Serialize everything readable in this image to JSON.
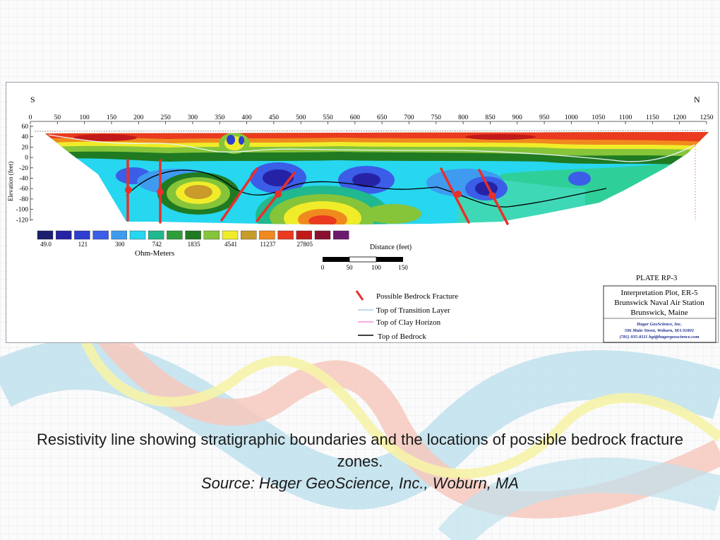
{
  "colors": {
    "background_grid": "#e6e9ec",
    "ribbon_blue": "#bfe1ec",
    "ribbon_red": "#f6c9bd",
    "ribbon_yellow": "#f6f3a8",
    "fracture_red": "#e8302a",
    "bedrock_line": "#000000",
    "transition_line": "#9ec3d6",
    "clay_line": "#f07ad6"
  },
  "plot": {
    "compass_left": "S",
    "compass_right": "N",
    "x_ticks": [
      "0",
      "50",
      "100",
      "150",
      "200",
      "250",
      "300",
      "350",
      "400",
      "450",
      "500",
      "550",
      "600",
      "650",
      "700",
      "750",
      "800",
      "850",
      "900",
      "950",
      "1000",
      "1050",
      "1100",
      "1150",
      "1200",
      "1250"
    ],
    "y_ticks": [
      "60",
      "40",
      "20",
      "0",
      "-20",
      "-40",
      "-60",
      "-80",
      "-100",
      "-120"
    ],
    "y_label": "Elevation (feet)",
    "distance_label": "Distance (feet)",
    "scale_ticks": [
      "0",
      "50",
      "100",
      "150"
    ],
    "scale_bar_label": "Distance (feet)"
  },
  "color_scale": {
    "swatches": [
      "#1c1e6e",
      "#2622a6",
      "#2d3ed0",
      "#3b5de8",
      "#3e9bef",
      "#27d6ef",
      "#20b88e",
      "#2d9e3a",
      "#1f7a22",
      "#86c43a",
      "#f0ec2a",
      "#c89b2a",
      "#f08a1e",
      "#ea3a1f",
      "#c21a1a",
      "#8a1030",
      "#6c1a6e"
    ],
    "labels": [
      "49.0",
      "121",
      "300",
      "742",
      "1835",
      "4541",
      "11237",
      "27805"
    ],
    "unit": "Ohm-Meters"
  },
  "legend": {
    "items": [
      {
        "label": "Possible Bedrock Fracture",
        "symbol": "fracture"
      },
      {
        "label": "Top of Transition Layer",
        "symbol": "transition"
      },
      {
        "label": "Top of Clay Horizon",
        "symbol": "clay"
      },
      {
        "label": "Top of Bedrock",
        "symbol": "bedrock"
      }
    ]
  },
  "title_block": {
    "plate": "PLATE RP-3",
    "title_lines": [
      "Interpretation Plot, ER-5",
      "Brunswick Naval Air Station",
      "Brunswick, Maine"
    ],
    "company_lines": [
      "Hager GeoScience, Inc.",
      "596 Main Street, Woburn, MA 01801",
      "(781) 935-8111  hgi@hagergeoscience.com"
    ]
  },
  "caption": {
    "line1": "Resistivity line showing stratigraphic boundaries and the locations of possible bedrock fracture zones.",
    "line2": "Source: Hager GeoScience, Inc., Woburn, MA"
  }
}
